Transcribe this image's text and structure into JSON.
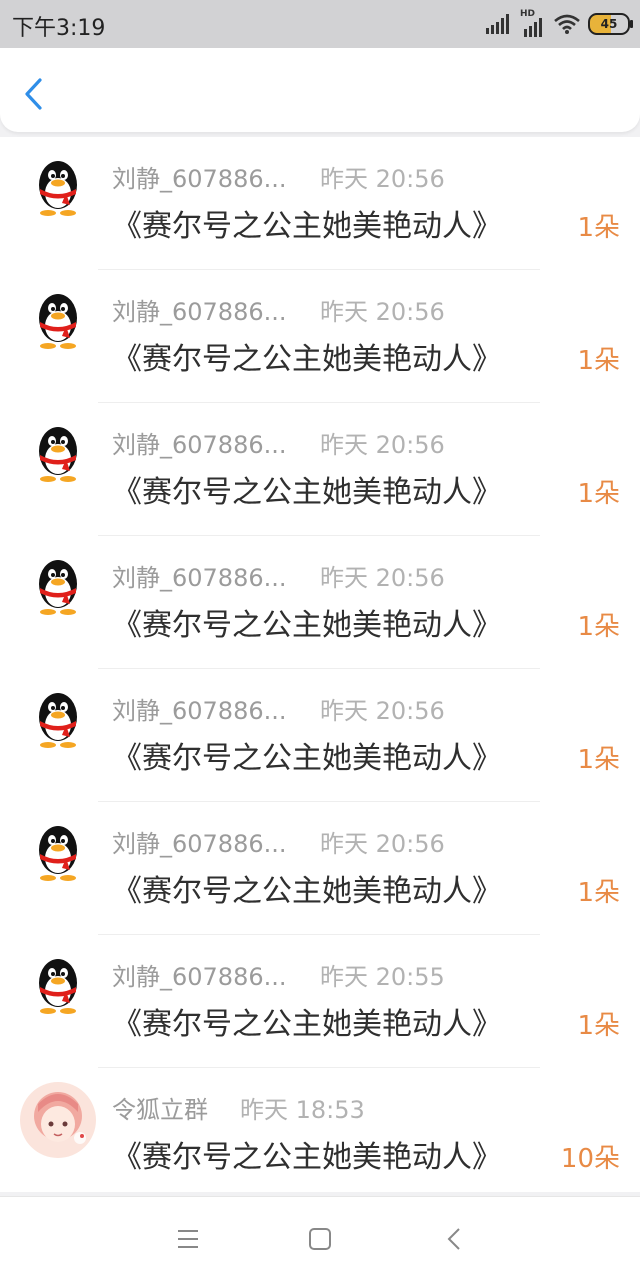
{
  "status_bar": {
    "time": "下午3:19",
    "network": "HD",
    "battery": "45"
  },
  "header": {
    "back_icon": "chevron-left-icon",
    "accent_color": "#2f8ee8"
  },
  "gifts": [
    {
      "name": "刘静_607886...",
      "time": "昨天 20:56",
      "gift": "《赛尔号之公主她美艳动人》",
      "count": "1朵",
      "avatar": "qq-penguin"
    },
    {
      "name": "刘静_607886...",
      "time": "昨天 20:56",
      "gift": "《赛尔号之公主她美艳动人》",
      "count": "1朵",
      "avatar": "qq-penguin"
    },
    {
      "name": "刘静_607886...",
      "time": "昨天 20:56",
      "gift": "《赛尔号之公主她美艳动人》",
      "count": "1朵",
      "avatar": "qq-penguin"
    },
    {
      "name": "刘静_607886...",
      "time": "昨天 20:56",
      "gift": "《赛尔号之公主她美艳动人》",
      "count": "1朵",
      "avatar": "qq-penguin"
    },
    {
      "name": "刘静_607886...",
      "time": "昨天 20:56",
      "gift": "《赛尔号之公主她美艳动人》",
      "count": "1朵",
      "avatar": "qq-penguin"
    },
    {
      "name": "刘静_607886...",
      "time": "昨天 20:56",
      "gift": "《赛尔号之公主她美艳动人》",
      "count": "1朵",
      "avatar": "qq-penguin"
    },
    {
      "name": "刘静_607886...",
      "time": "昨天 20:55",
      "gift": "《赛尔号之公主她美艳动人》",
      "count": "1朵",
      "avatar": "qq-penguin"
    },
    {
      "name": "令狐立群",
      "time": "昨天 18:53",
      "gift": "《赛尔号之公主她美艳动人》",
      "count": "10朵",
      "avatar": "anime-girl-avatar"
    }
  ],
  "colors": {
    "count": "#e88a45",
    "name": "#9b9b9b",
    "time": "#b2b2b2"
  },
  "nav": {
    "menu_icon": "menu-icon",
    "home_icon": "square-home-icon",
    "back_icon": "triangle-back-icon"
  }
}
